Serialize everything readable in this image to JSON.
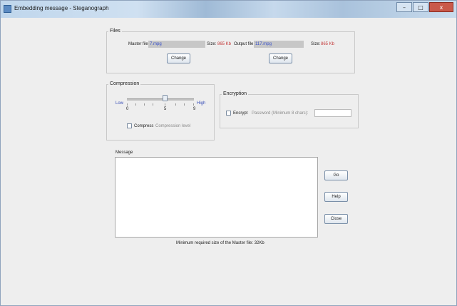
{
  "window": {
    "title": "Embedding message - Steganograph",
    "minimize": "–",
    "maximize": "□",
    "close": "x"
  },
  "files": {
    "title": "Files",
    "master_label": "Master file",
    "master_value": "7.mpg",
    "master_size_label": "Size:",
    "master_size_value": "865 Kb",
    "output_label": "Output file",
    "output_value": "117.mpg",
    "output_size_label": "Size:",
    "output_size_value": "865 Kb",
    "change_master": "Change",
    "change_output": "Change"
  },
  "compression": {
    "title": "Compression",
    "low": "Low",
    "high": "High",
    "tick_min": "0",
    "tick_mid": "5",
    "tick_max": "9",
    "level": 5,
    "compress_label": "Compress",
    "compress_hint": "Compression level"
  },
  "encryption": {
    "title": "Encryption",
    "encrypt_label": "Encrypt",
    "password_label": "Password (Minimum 8 chars):",
    "password_value": ""
  },
  "message": {
    "title": "Message",
    "footer": "Minimum required size of the Master file: 32Kb"
  },
  "actions": {
    "go": "Go",
    "help": "Help",
    "close": "Close"
  }
}
